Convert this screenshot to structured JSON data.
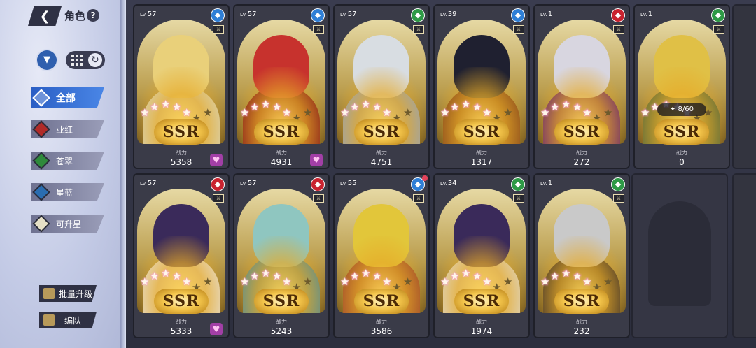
{
  "header": {
    "title": "角色",
    "help_icon": "?"
  },
  "filters": [
    {
      "label": "全部",
      "icon": "all-grid-icon",
      "active": true
    },
    {
      "label": "业红",
      "icon": "red-element-icon",
      "color": "#b02a28"
    },
    {
      "label": "苍翠",
      "icon": "green-element-icon",
      "color": "#2e8a3b"
    },
    {
      "label": "星蓝",
      "icon": "blue-element-icon",
      "color": "#2a6db0"
    },
    {
      "label": "可升星",
      "icon": "star-up-icon",
      "color": "#2a2c3b"
    }
  ],
  "buttons": {
    "batch_upgrade": "批量升级",
    "formation": "编队"
  },
  "power_label": "战力",
  "rarity": "SSR",
  "lv_prefix": "Lv.",
  "cards": [
    {
      "level": "57",
      "power": "5358",
      "element_color": "#2f7fd6",
      "heart": true,
      "hair": "#e9d07a",
      "outfit": "#d9d2b0"
    },
    {
      "level": "57",
      "power": "4931",
      "element_color": "#2f7fd6",
      "heart": true,
      "hair": "#c7322d",
      "outfit": "#8a2019"
    },
    {
      "level": "57",
      "power": "4751",
      "element_color": "#2e9a46",
      "heart": false,
      "hair": "#d8dde2",
      "outfit": "#9aa3ad"
    },
    {
      "level": "39",
      "power": "1317",
      "element_color": "#2f7fd6",
      "heart": false,
      "hair": "#1f2030",
      "outfit": "#8a4a1c"
    },
    {
      "level": "1",
      "power": "272",
      "element_color": "#c9232f",
      "heart": false,
      "hair": "#d8d6e0",
      "outfit": "#6e2b6b"
    },
    {
      "level": "1",
      "power": "0",
      "element_color": "#2e9a46",
      "heart": false,
      "shards": "8/60",
      "hair": "#e0c046",
      "outfit": "#5b6b3a"
    },
    {
      "level": "57",
      "power": "5333",
      "element_color": "#c9232f",
      "heart": true,
      "hair": "#3a2a5a",
      "outfit": "#e6dccb"
    },
    {
      "level": "57",
      "power": "5243",
      "element_color": "#c9232f",
      "heart": false,
      "hair": "#8fc6c0",
      "outfit": "#5a8d8d"
    },
    {
      "level": "55",
      "power": "3586",
      "element_color": "#2f7fd6",
      "heart": false,
      "notify": true,
      "hair": "#e2c63a",
      "outfit": "#a04a2a"
    },
    {
      "level": "34",
      "power": "1974",
      "element_color": "#2e9a46",
      "heart": false,
      "hair": "#3a2a5a",
      "outfit": "#ded4bf"
    },
    {
      "level": "1",
      "power": "232",
      "element_color": "#2e9a46",
      "heart": false,
      "hair": "#c9c9c9",
      "outfit": "#4a3a2a"
    }
  ]
}
